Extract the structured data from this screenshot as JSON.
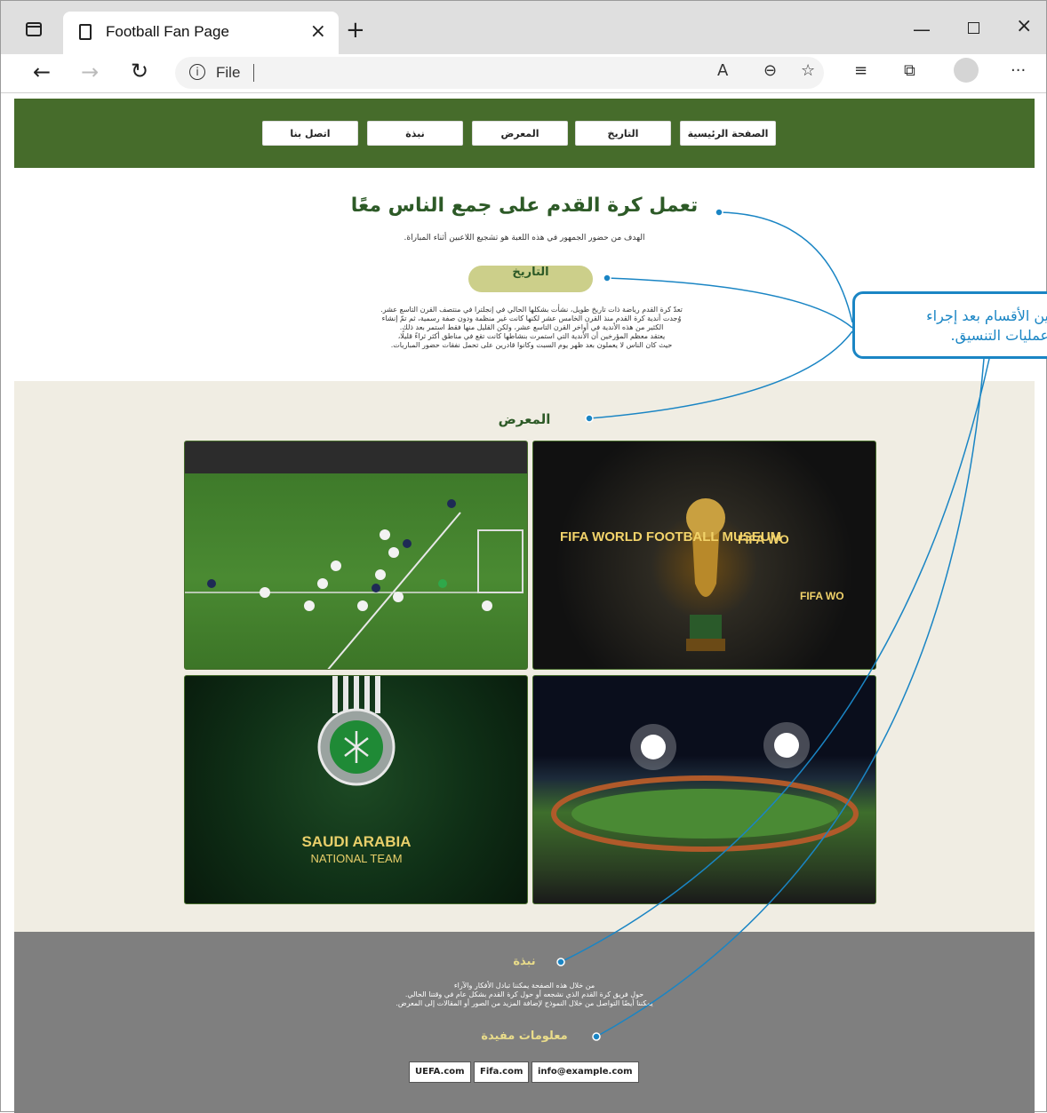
{
  "browser": {
    "tab_title": "Football Fan Page",
    "address": "File",
    "icons": [
      "tab-list-icon",
      "page-icon",
      "close-icon",
      "new-tab-icon",
      "minimize-icon",
      "maximize-icon",
      "window-close-icon",
      "back-icon",
      "forward-icon",
      "reload-icon",
      "info-icon",
      "read-aloud-icon",
      "zoom-out-icon",
      "favorite-add-icon",
      "favorites-icon",
      "collections-icon",
      "profile-icon",
      "more-icon"
    ]
  },
  "nav": {
    "items": [
      "الصفحة الرئيسية",
      "التاريخ",
      "المعرض",
      "نبذة",
      "اتصل بنا"
    ]
  },
  "intro": {
    "title": "تعمل كرة القدم على جمع الناس معًا",
    "subtitle": "الهدف من حضور الجمهور في هذه اللعبة هو تشجيع اللاعبين أثناء المباراة.",
    "history_heading": "التاريخ",
    "history_lines": [
      "تعدّ كرة القدم رياضة ذات تاريخ طويل، نشأت بشكلها الحالي في إنجلترا في منتصف القرن التاسع عشر.",
      "وُجدت أندية كرة القدم منذ القرن الخامس عشر لكنها كانت غير منظمة ودون صفة رسمية، ثم تمّ إنشاء",
      "الكثير من هذه الأندية في أواخر القرن التاسع عشر، ولكن القليل منها فقط استمر بعد ذلك.",
      "يعتقد معظم المؤرخين أن الأندية التي استمرت بنشاطها كانت تقع في مناطق أكثر ثراءً قليلًا،",
      "حيث كان الناس لا يعملون بعد ظهر يوم السبت وكانوا قادرين على تحمل نفقات حضور المباريات."
    ]
  },
  "gallery": {
    "title": "المعرض",
    "photos": [
      {
        "caption": "",
        "overlay": ""
      },
      {
        "caption": "FIFA WORLD FOOTBALL MUSEUM",
        "overlay": ""
      },
      {
        "caption": "SAUDI ARABIA",
        "overlay": "NATIONAL TEAM"
      },
      {
        "caption": "",
        "overlay": ""
      }
    ]
  },
  "footer": {
    "about_title": "نبذة",
    "about_lines": [
      "من خلال هذه الصفحة يمكننا تبادل الأفكار والآراء",
      "حول فريق كرة القدم الذي نشجعه أو حول كرة القدم بشكل عام في وقتنا الحالي.",
      "يمكننا أيضًا التواصل من خلال النموذج لإضافة المزيد من الصور أو المقالات إلى المعرض."
    ],
    "info_title": "معلومات مفيدة",
    "links": [
      "UEFA.com",
      "Fifa.com",
      "info@example.com"
    ]
  },
  "annotation": {
    "line1": "ين الأقسام بعد إجراء",
    "line2": "عمليات التنسيق."
  },
  "colors": {
    "header": "#466c2b",
    "title_green": "#2d5a27",
    "pill": "#cccf8a",
    "gallery_bg": "#f0ede3",
    "footer_bg": "#7f7f7f",
    "footer_heading": "#e9dc8a",
    "annotation": "#1a85c4"
  }
}
